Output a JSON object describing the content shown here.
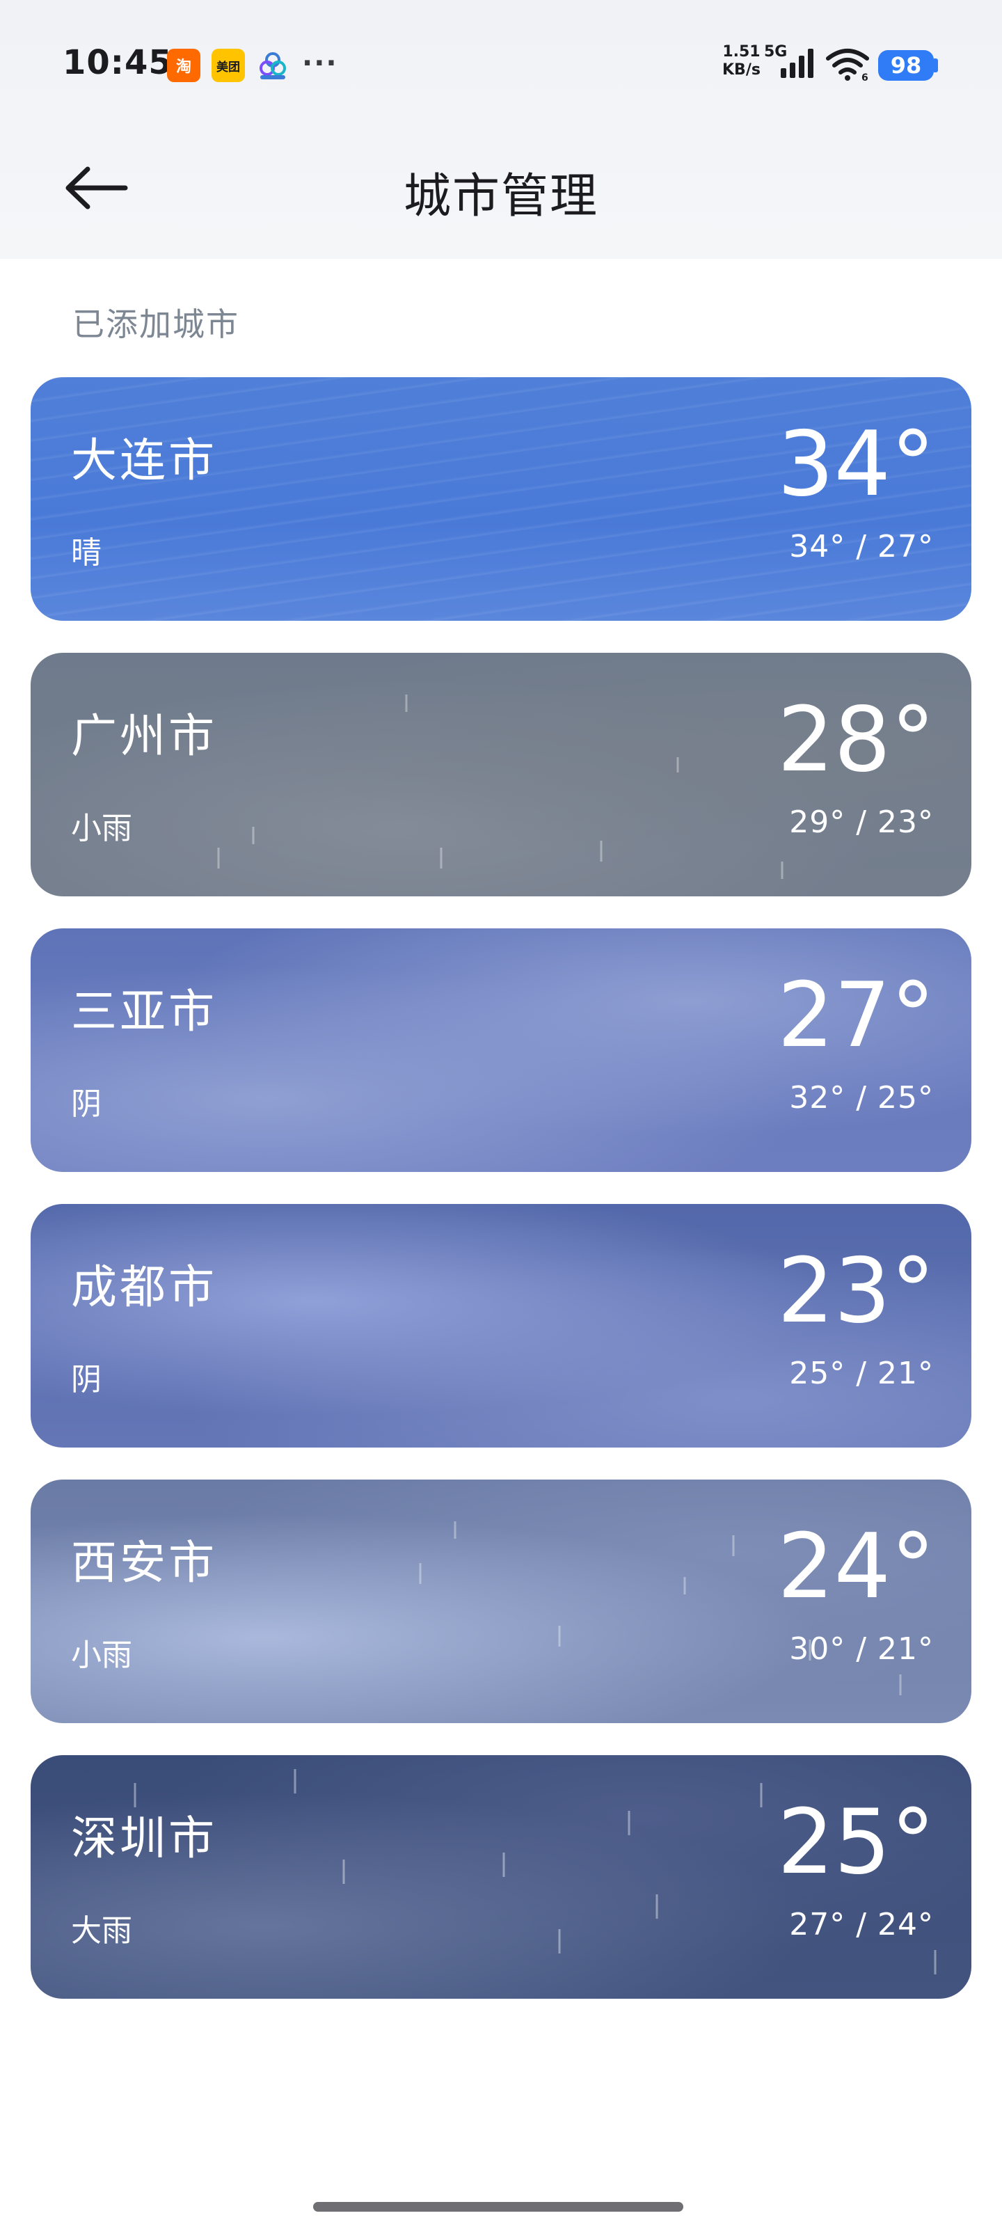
{
  "status_bar": {
    "time": "10:45",
    "app_icons": [
      {
        "name": "taobao",
        "text": "淘",
        "color": "#ff6a00"
      },
      {
        "name": "meituan",
        "text": "美团",
        "color": "#ffc300"
      },
      {
        "name": "app-icon",
        "text": ""
      }
    ],
    "more": "···",
    "net_speed_value": "1.51",
    "net_speed_unit": "KB/s",
    "network_type": "5G",
    "wifi_slot": "6",
    "battery": "98",
    "battery_color": "#2f7cf6"
  },
  "header": {
    "title": "城市管理",
    "back_icon": "arrow-left-icon"
  },
  "section": {
    "label": "已添加城市"
  },
  "cities": [
    {
      "name": "大连市",
      "condition": "晴",
      "temp": "34°",
      "range": "34° / 27°"
    },
    {
      "name": "广州市",
      "condition": "小雨",
      "temp": "28°",
      "range": "29° / 23°"
    },
    {
      "name": "三亚市",
      "condition": "阴",
      "temp": "27°",
      "range": "32° / 25°"
    },
    {
      "name": "成都市",
      "condition": "阴",
      "temp": "23°",
      "range": "25° / 21°"
    },
    {
      "name": "西安市",
      "condition": "小雨",
      "temp": "24°",
      "range": "30° / 21°"
    },
    {
      "name": "深圳市",
      "condition": "大雨",
      "temp": "25°",
      "range": "27° / 24°"
    }
  ]
}
